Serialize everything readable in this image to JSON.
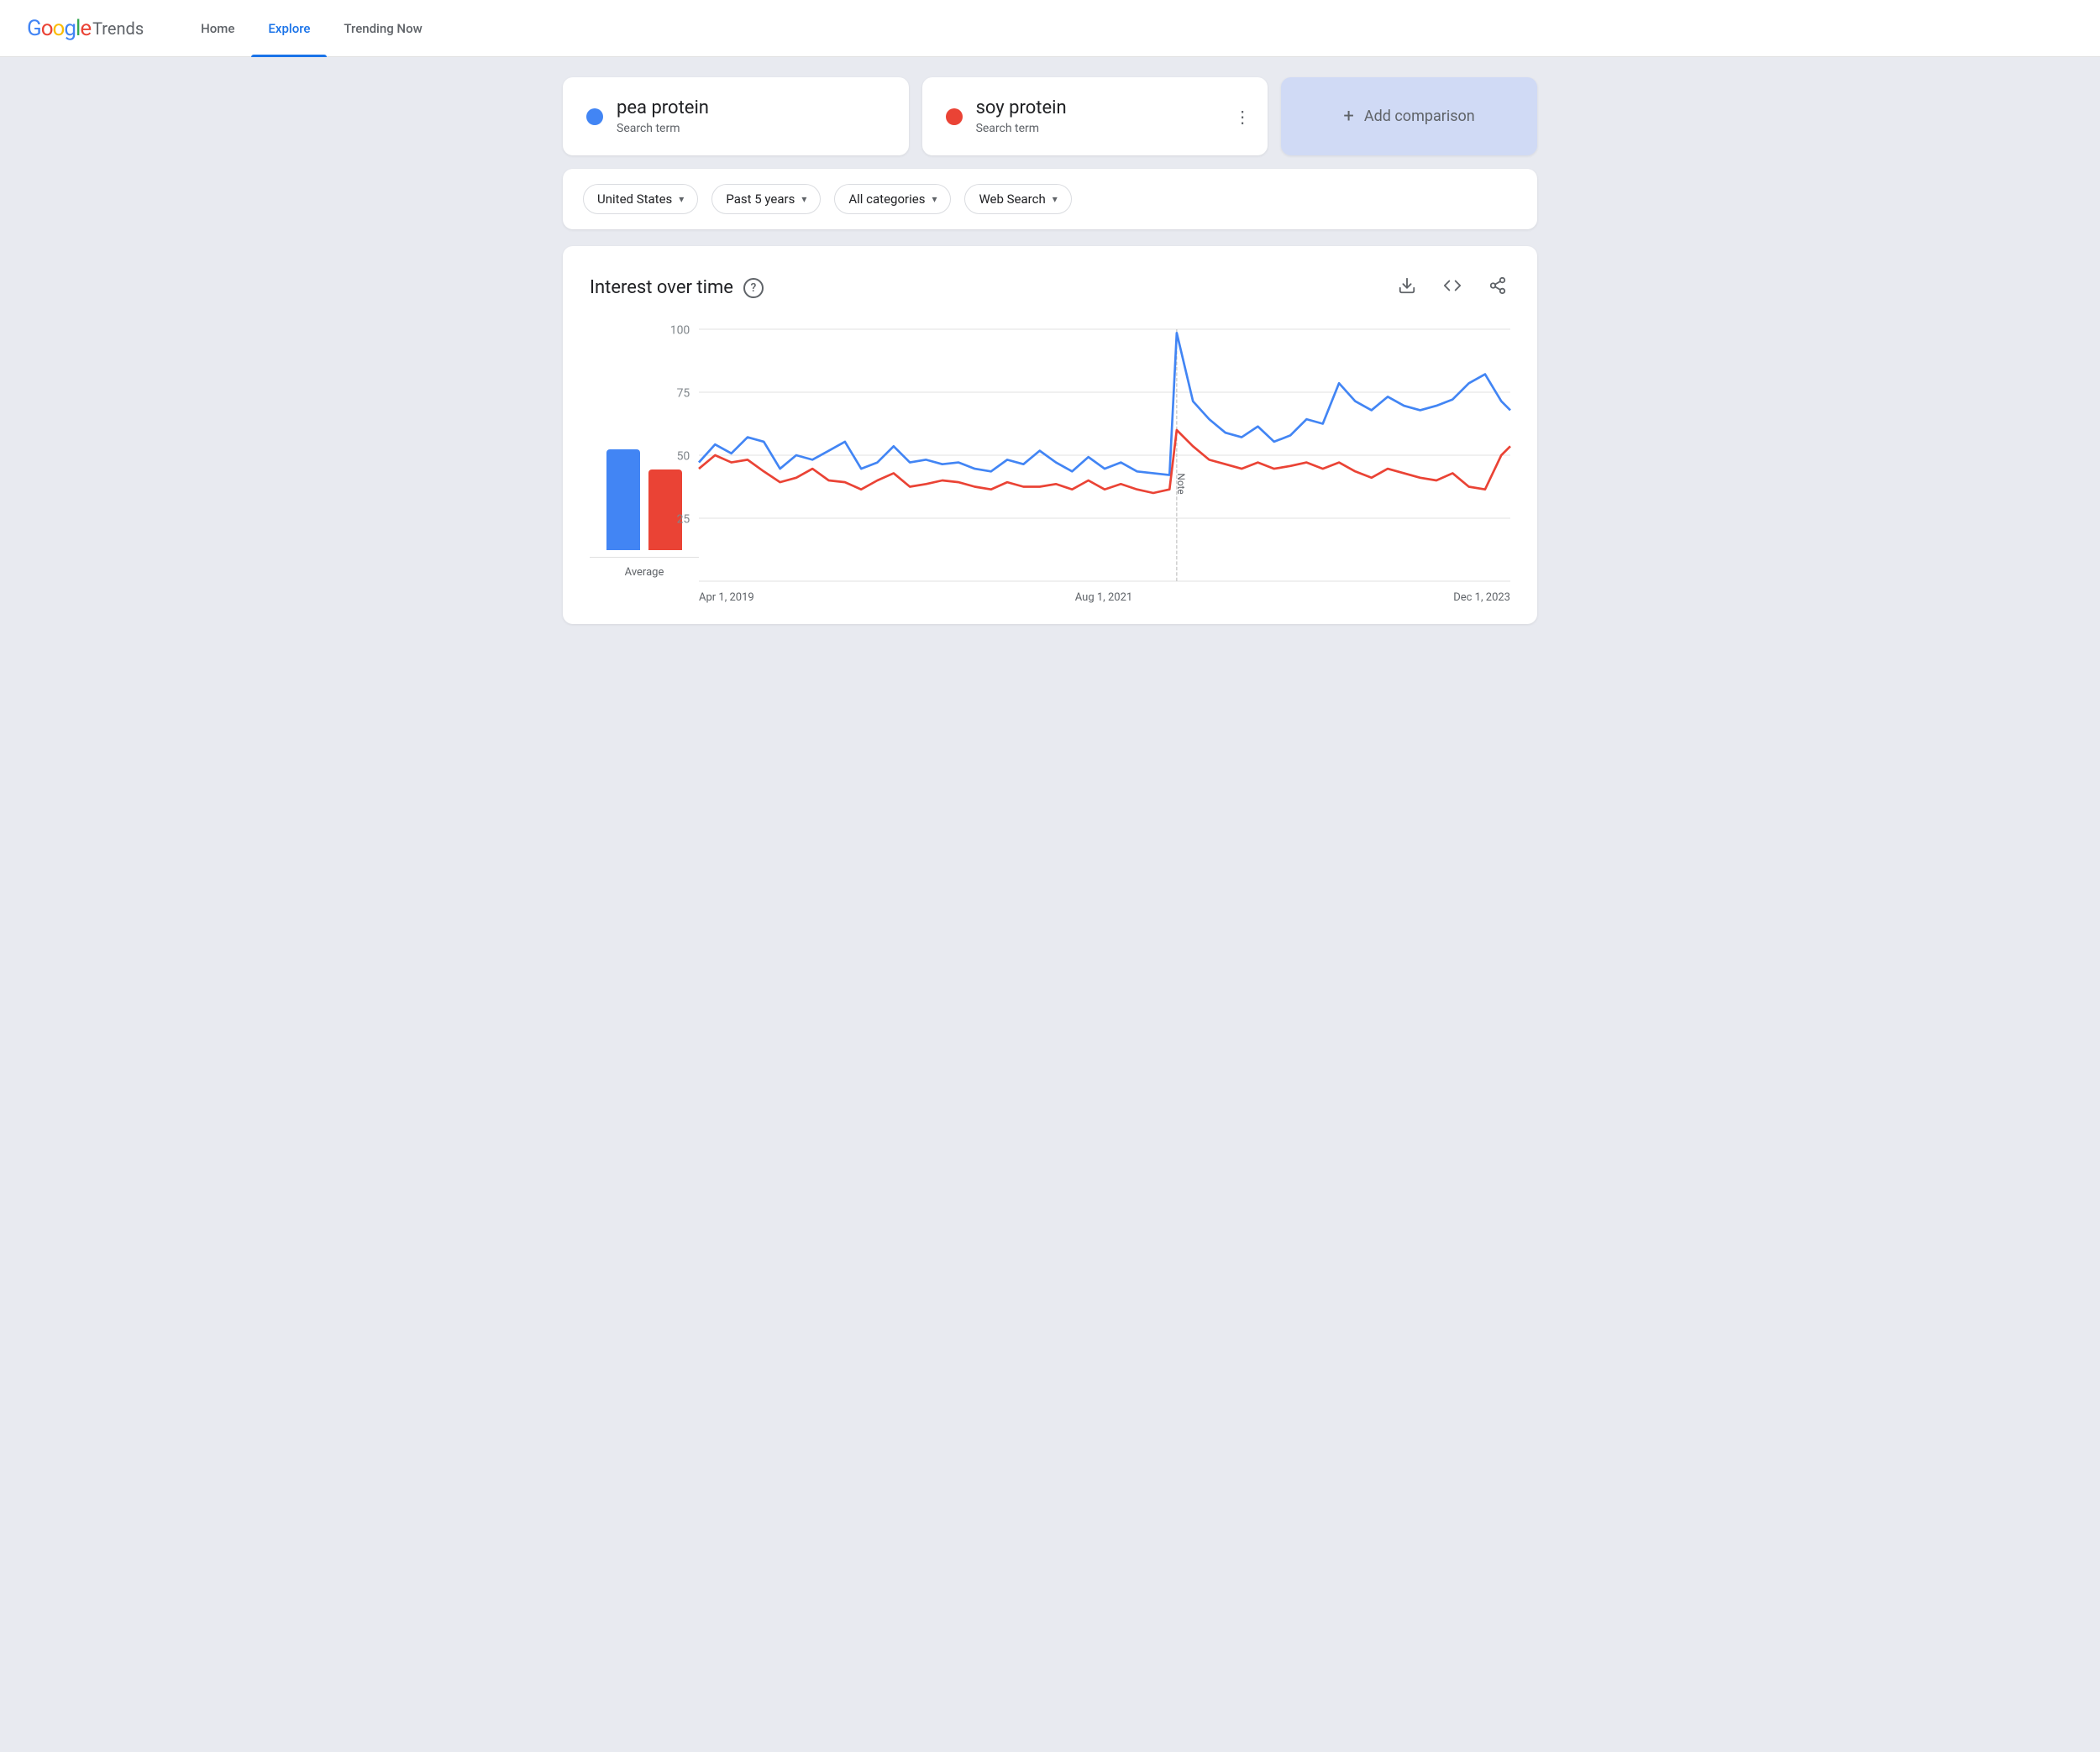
{
  "header": {
    "logo_google": "Google",
    "logo_trends": "Trends",
    "nav": [
      {
        "id": "home",
        "label": "Home",
        "active": false
      },
      {
        "id": "explore",
        "label": "Explore",
        "active": true
      },
      {
        "id": "trending-now",
        "label": "Trending Now",
        "active": false
      }
    ]
  },
  "search_terms": [
    {
      "id": "pea-protein",
      "term": "pea protein",
      "type": "Search term",
      "color": "#4285F4",
      "has_menu": false
    },
    {
      "id": "soy-protein",
      "term": "soy protein",
      "type": "Search term",
      "color": "#EA4335",
      "has_menu": true
    }
  ],
  "add_comparison": {
    "label": "Add comparison",
    "plus": "+"
  },
  "filters": [
    {
      "id": "region",
      "label": "United States",
      "has_chevron": true
    },
    {
      "id": "time",
      "label": "Past 5 years",
      "has_chevron": true
    },
    {
      "id": "category",
      "label": "All categories",
      "has_chevron": true
    },
    {
      "id": "search-type",
      "label": "Web Search",
      "has_chevron": true
    }
  ],
  "chart": {
    "title": "Interest over time",
    "help_icon": "?",
    "actions": [
      {
        "id": "download",
        "symbol": "⬇",
        "label": "Download"
      },
      {
        "id": "embed",
        "symbol": "<>",
        "label": "Embed"
      },
      {
        "id": "share",
        "symbol": "↗",
        "label": "Share"
      }
    ],
    "y_labels": [
      "100",
      "75",
      "50",
      "25"
    ],
    "x_labels": [
      "Apr 1, 2019",
      "Aug 1, 2021",
      "Dec 1, 2023"
    ],
    "note_label": "Note",
    "average_label": "Average",
    "bar_blue_height_pct": 100,
    "bar_red_height_pct": 80
  }
}
